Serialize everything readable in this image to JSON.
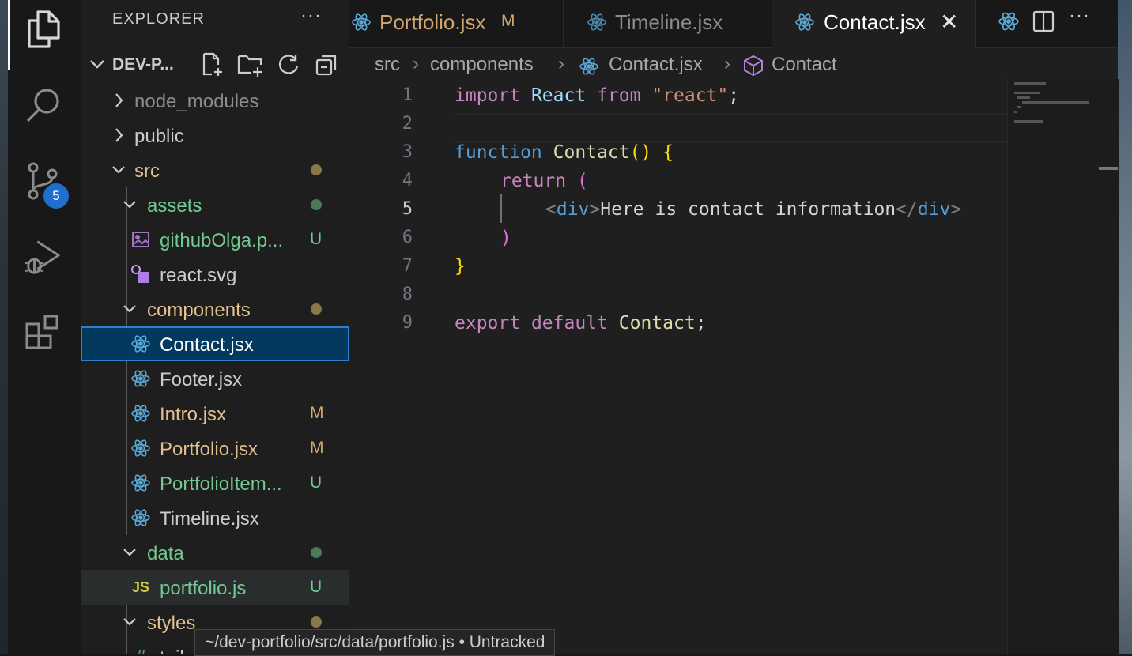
{
  "activity_bar": {
    "scm_badge": "5",
    "icons": [
      "files-icon",
      "search-icon",
      "source-control-icon",
      "run-debug-icon",
      "extensions-icon"
    ]
  },
  "sidebar": {
    "title": "EXPLORER",
    "more": "···",
    "project": "DEV-P...",
    "tree": [
      {
        "label": "node_modules",
        "color": "#8c8c8c",
        "badge": "",
        "dot": ""
      },
      {
        "label": "public",
        "color": "#cccccc",
        "badge": "",
        "dot": ""
      },
      {
        "label": "src",
        "color": "#e2c08d",
        "badge": "",
        "dot": "#8a7848"
      },
      {
        "label": "assets",
        "color": "#73c991",
        "badge": "",
        "dot": "#4b7a57"
      },
      {
        "label": "githubOlga.p...",
        "color": "#73c991",
        "badge": "U",
        "dot": ""
      },
      {
        "label": "react.svg",
        "color": "#cccccc",
        "badge": "",
        "dot": ""
      },
      {
        "label": "components",
        "color": "#e2c08d",
        "badge": "",
        "dot": "#8a7848"
      },
      {
        "label": "Contact.jsx",
        "color": "#ffffff",
        "badge": "",
        "dot": ""
      },
      {
        "label": "Footer.jsx",
        "color": "#cccccc",
        "badge": "",
        "dot": ""
      },
      {
        "label": "Intro.jsx",
        "color": "#e2c08d",
        "badge": "M",
        "dot": ""
      },
      {
        "label": "Portfolio.jsx",
        "color": "#e2c08d",
        "badge": "M",
        "dot": ""
      },
      {
        "label": "PortfolioItem...",
        "color": "#73c991",
        "badge": "U",
        "dot": ""
      },
      {
        "label": "Timeline.jsx",
        "color": "#cccccc",
        "badge": "",
        "dot": ""
      },
      {
        "label": "data",
        "color": "#73c991",
        "badge": "",
        "dot": "#4b7a57"
      },
      {
        "label": "portfolio.js",
        "color": "#73c991",
        "badge": "U",
        "dot": ""
      },
      {
        "label": "styles",
        "color": "#e2c08d",
        "badge": "",
        "dot": "#8a7848"
      },
      {
        "label": "tailw...",
        "color": "#cccccc",
        "badge": "",
        "dot": ""
      }
    ],
    "js_icon_text": "JS"
  },
  "tabs": [
    {
      "label": "Portfolio.jsx",
      "modified": "M",
      "color": "#d0a770"
    },
    {
      "label": "Timeline.jsx",
      "modified": "",
      "color": "#8b8b8b"
    },
    {
      "label": "Contact.jsx",
      "modified": "",
      "color": "#ffffff"
    }
  ],
  "tab_actions": {
    "more": "···"
  },
  "breadcrumb": {
    "items": [
      "src",
      "components",
      "Contact.jsx",
      "Contact"
    ]
  },
  "code": {
    "line_numbers": [
      "1",
      "2",
      "3",
      "4",
      "5",
      "6",
      "7",
      "8",
      "9"
    ],
    "current_line": "5",
    "import_kw": "import",
    "react_id": "React",
    "from_kw": "from",
    "react_str": "\"react\"",
    "semi": ";",
    "function_kw": "function",
    "fn_name": "Contact",
    "parens": "()",
    "open_brace": "{",
    "return_kw": "return",
    "open_paren": "(",
    "tag_open_lt": "<",
    "div_open": "div",
    "tag_open_gt": ">",
    "div_text": "Here is contact information",
    "tag_close_lt": "</",
    "div_close": "div",
    "tag_close_gt": ">",
    "close_paren": ")",
    "close_brace": "}",
    "export_kw": "export",
    "default_kw": "default",
    "export_id": "Contact",
    "semi2": ";"
  },
  "tooltip": "~/dev-portfolio/src/data/portfolio.js • Untracked"
}
